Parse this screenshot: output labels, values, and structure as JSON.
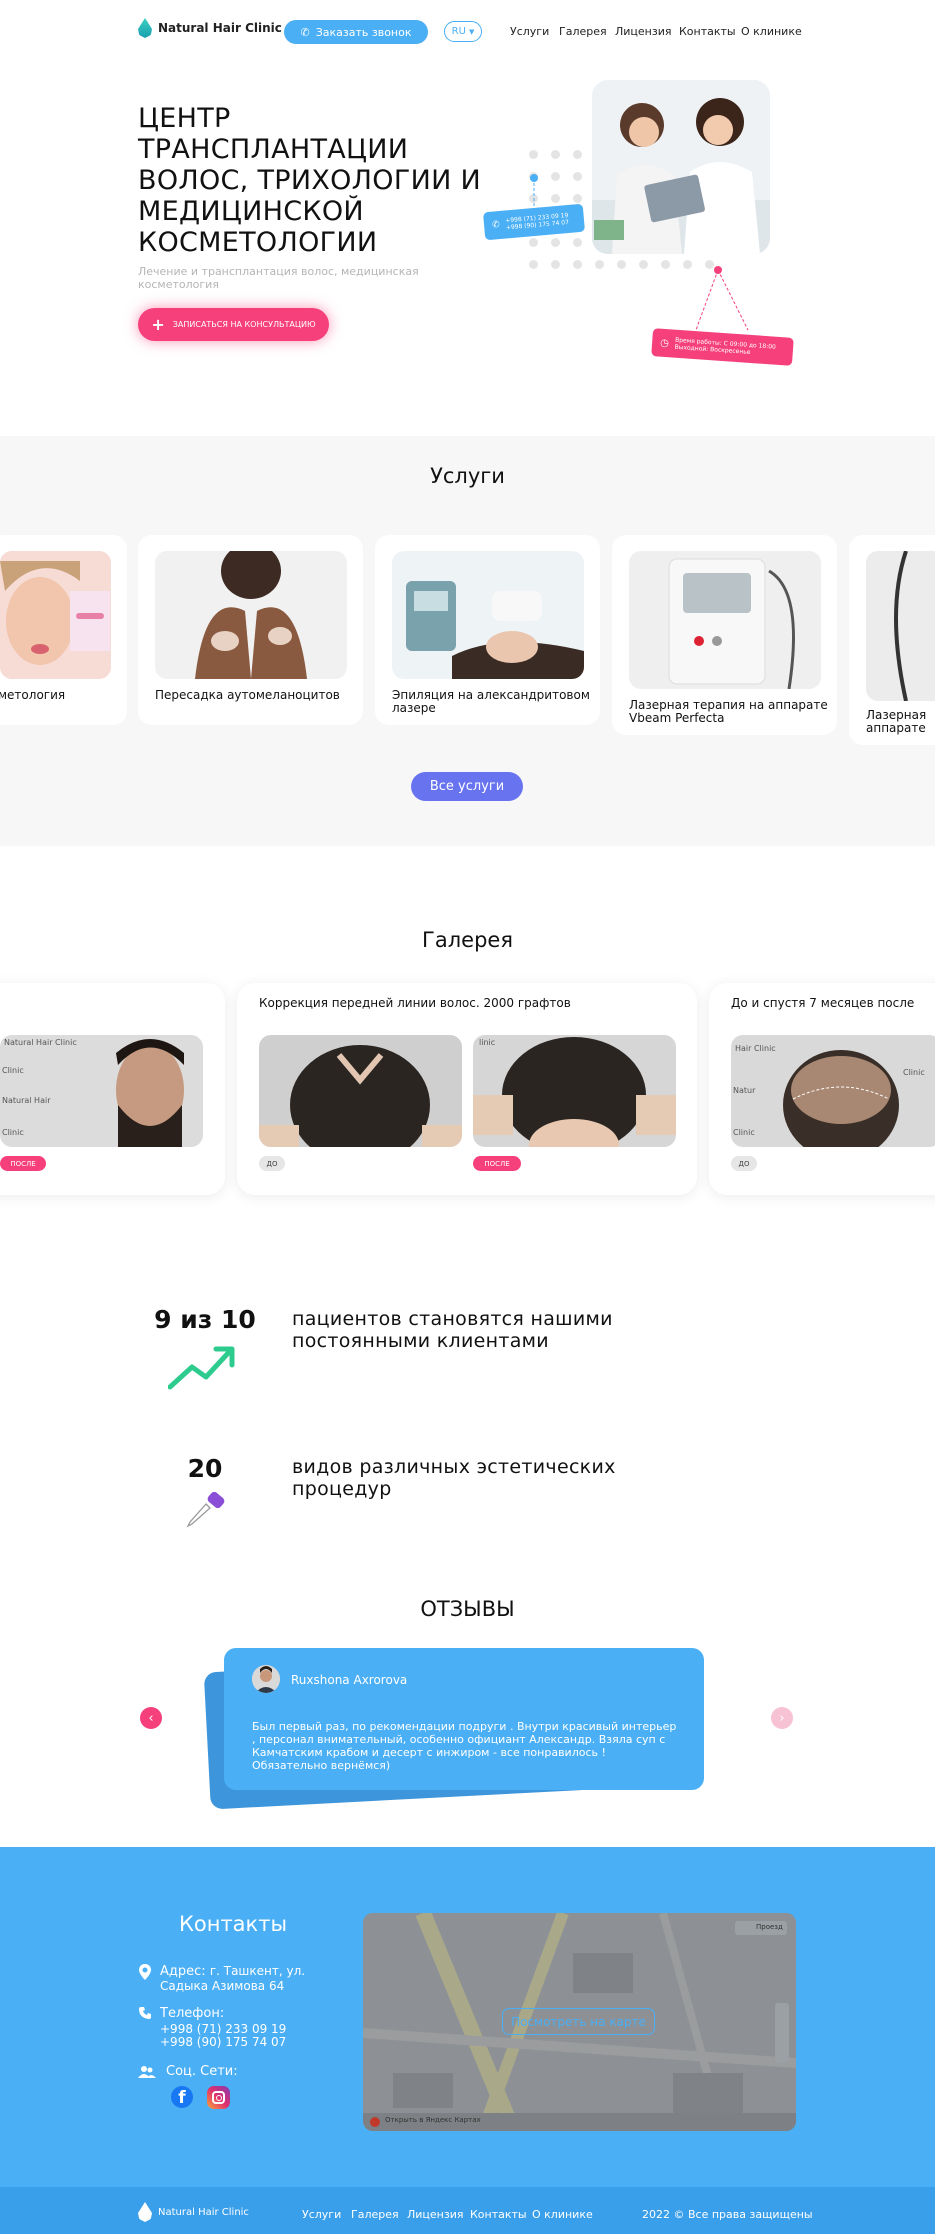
{
  "header": {
    "logo_text": "Natural Hair Clinic",
    "call_button": "Заказать звонок",
    "lang": "RU",
    "nav": [
      "Услуги",
      "Галерея",
      "Лицензия",
      "Контакты",
      "О клинике"
    ]
  },
  "hero": {
    "title_lines": [
      "ЦЕНТР",
      "ТРАНСПЛАНТАЦИИ",
      "ВОЛОС, ТРИХОЛОГИИ И",
      "МЕДИЦИНСКОЙ",
      "КОСМЕТОЛОГИИ"
    ],
    "subtitle": "Лечение и трансплантация волос, медицинская косметология",
    "cta": "ЗАПИСАТЬСЯ НА КОНСУЛЬТАЦИЮ",
    "phone_tag": [
      "+998 (71) 233 09 19",
      "+998 (90) 175 74 07"
    ],
    "hours_tag": [
      "Время работы: С 09:00 до 18:00",
      "Выходной: Воскресенье"
    ]
  },
  "services": {
    "title": "Услуги",
    "cards": [
      {
        "label": "метология"
      },
      {
        "label": "Пересадка аутомеланоцитов"
      },
      {
        "label": "Эпиляция на александритовом лазере"
      },
      {
        "label": "Лазерная терапия на аппарате Vbeam Perfecta"
      },
      {
        "label": "Лазерная аппарате"
      }
    ],
    "all_button": "Все услуги"
  },
  "gallery": {
    "title": "Галерея",
    "cards": [
      {
        "title": "",
        "badge": "ПОСЛЕ"
      },
      {
        "title": "Коррекция передней линии волос. 2000 графтов",
        "badges": [
          "ДО",
          "ПОСЛЕ"
        ]
      },
      {
        "title": "До и спустя 7 месяцев после",
        "badge": "ДО"
      }
    ],
    "photo_watermark": [
      "Natural Hair Clinic"
    ]
  },
  "stats": [
    {
      "number": "9 из 10",
      "text": "пациентов становятся нашими постоянными клиентами",
      "icon": "trend-up-icon"
    },
    {
      "number": "20",
      "text": "видов различных эстетических процедур",
      "icon": "dropper-icon"
    }
  ],
  "reviews": {
    "title": "ОТЗЫВЫ",
    "author": "Ruxshona Axrorova",
    "text": "Был первый раз, по рекомендации подруги . Внутри красивый интерьер , персонал внимательный, особенно официант Александр. Взяла суп с Камчатским крабом и десерт с инжиром - все понравилось ! Обязательно вернёмся)"
  },
  "contacts": {
    "title": "Контакты",
    "address_label": "Адрес:",
    "address_value": "г. Ташкент, ул. Садыка Азимова 64",
    "phone_label": "Телефон:",
    "phones": [
      "+998 (71) 233 09 19",
      "+998 (90) 175 74 07"
    ],
    "social_label": "Соц. Сети:",
    "map_button": "Посмотреть на карте",
    "map_footer": "Открыть в Яндекс Картах",
    "map_route": "Проезд"
  },
  "footer": {
    "logo_text": "Natural Hair Clinic",
    "nav": [
      "Услуги",
      "Галерея",
      "Лицензия",
      "Контакты",
      "О клинике"
    ],
    "copyright": "2022 © Все права защищены"
  },
  "colors": {
    "blue": "#4aaff5",
    "pink": "#f5407c",
    "violet": "#6873f0",
    "green": "#2ecb8f"
  }
}
